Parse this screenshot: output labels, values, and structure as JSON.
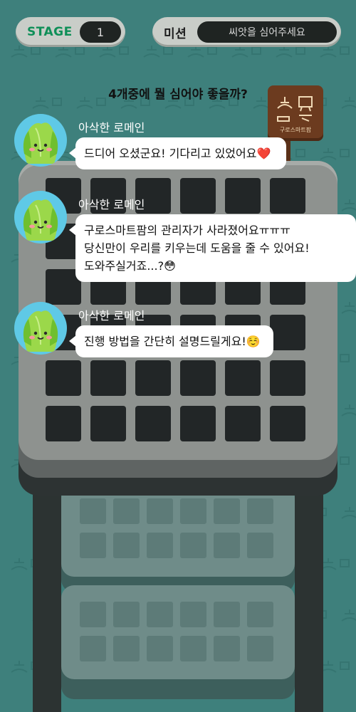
{
  "hud": {
    "stage_label": "STAGE",
    "stage_value": "1",
    "mission_label": "미션",
    "mission_value": "씨앗을 심어주세요"
  },
  "question": "4개중에 뭘 심어야 좋을까?",
  "sign": {
    "text": "구로스마트팜"
  },
  "messages": [
    {
      "sender": "아삭한 로메인",
      "lines": [
        "드디어 오셨군요! 기다리고 있었어요",
        "❤️"
      ]
    },
    {
      "sender": "아삭한 로메인",
      "lines": [
        "구로스마트팜의 관리자가 사라졌어요ㅠㅠㅠ",
        "당신만이 우리를 키우는데 도움을 줄 수 있어요!",
        "도와주실거죠...?😳"
      ]
    },
    {
      "sender": "아삭한 로메인",
      "lines": [
        "진행 방법을 간단히 설명드릴게요!☺️"
      ]
    }
  ],
  "colors": {
    "background": "#3e807c",
    "stage_text": "#0e8f58",
    "avatar_bg": "#5fc9e6",
    "sign_wood": "#6c3b1f"
  },
  "icons": [
    "lettuce-avatar-icon",
    "greenhouse-pattern-icon",
    "farm-sign-icon"
  ]
}
